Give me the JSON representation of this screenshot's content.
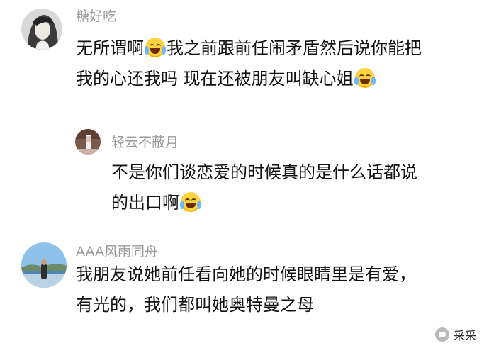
{
  "comments": [
    {
      "username": "糖好吃",
      "line1_a": "无所谓啊",
      "line1_b": "我之前跟前任闹矛盾然后说你能把",
      "line2": "我的心还我吗 现在还被朋友叫缺心姐"
    },
    {
      "username": "轻云不蔽月",
      "line1": "不是你们谈恋爱的时候真的是什么话都说",
      "line2": "的出口啊"
    },
    {
      "username": "AAA风雨同舟",
      "line1": "我朋友说她前任看向她的时候眼睛里是有爱，",
      "line2": "有光的，我们都叫她奥特曼之母"
    }
  ],
  "watermark": {
    "text": "采采"
  },
  "icons": [
    "laugh-cry-emoji",
    "avatar-anime",
    "avatar-bottle",
    "avatar-seaside",
    "wechat-icon"
  ]
}
